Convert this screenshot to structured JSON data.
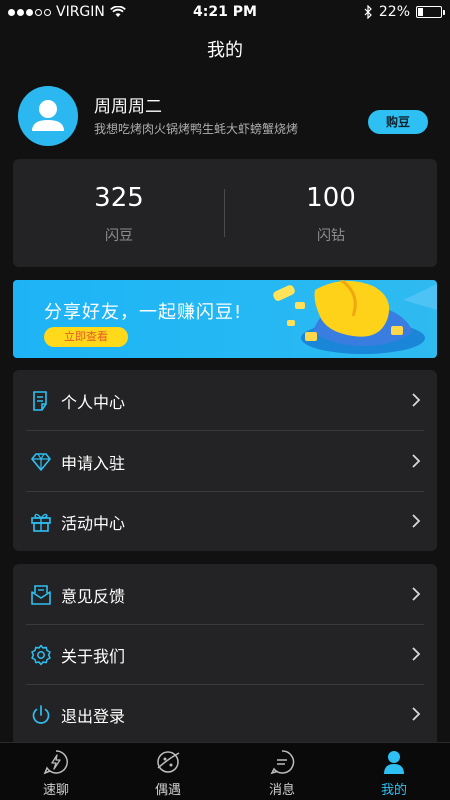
{
  "status_bar": {
    "carrier": "VIRGIN",
    "time": "4:21 PM",
    "battery_text": "22%",
    "battery_level": 0.22,
    "signal_bars_filled": 3,
    "signal_bars_total": 5
  },
  "header": {
    "title": "我的"
  },
  "profile": {
    "name": "周周周二",
    "signature": "我想吃烤肉火锅烤鸭生蚝大虾螃蟹烧烤",
    "buy_label": "购豆"
  },
  "stats": [
    {
      "value": "325",
      "label": "闪豆"
    },
    {
      "value": "100",
      "label": "闪钻"
    }
  ],
  "banner": {
    "text": "分享好友，一起赚闪豆!",
    "button_label": "立即查看"
  },
  "menu_group_1": [
    {
      "label": "个人中心",
      "icon": "document-icon"
    },
    {
      "label": "申请入驻",
      "icon": "diamond-icon"
    },
    {
      "label": "活动中心",
      "icon": "gift-icon"
    }
  ],
  "menu_group_2": [
    {
      "label": "意见反馈",
      "icon": "mail-icon"
    },
    {
      "label": "关于我们",
      "icon": "gear-icon"
    },
    {
      "label": "退出登录",
      "icon": "power-icon"
    }
  ],
  "tabs": [
    {
      "label": "速聊",
      "icon": "lightning-chat-icon",
      "active": false
    },
    {
      "label": "偶遇",
      "icon": "planet-icon",
      "active": false
    },
    {
      "label": "消息",
      "icon": "message-icon",
      "active": false
    },
    {
      "label": "我的",
      "icon": "person-icon",
      "active": true
    }
  ],
  "colors": {
    "accent": "#2ec0f2",
    "background": "#111112",
    "card": "#232325",
    "banner_button": "#ffd91a"
  }
}
